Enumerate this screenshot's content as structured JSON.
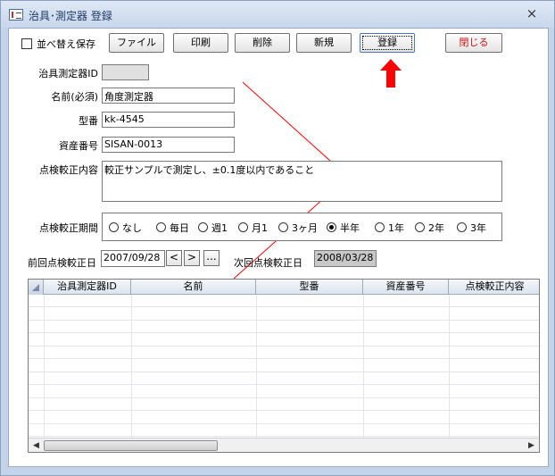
{
  "window": {
    "title": "治具･測定器  登録",
    "close_symbol": "×"
  },
  "toolbar": {
    "sort_save_label": "並べ替え保存",
    "buttons": {
      "file": "ファイル",
      "print": "印刷",
      "delete": "削除",
      "new": "新規",
      "register": "登録",
      "close": "閉じる"
    }
  },
  "form": {
    "labels": {
      "tool_id": "治具測定器ID",
      "name": "名前(必須)",
      "model": "型番",
      "asset_no": "資産番号",
      "inspection_content": "点検較正内容",
      "inspection_period": "点検較正期間",
      "last_date": "前回点検較正日",
      "next_date": "次回点検較正日"
    },
    "values": {
      "tool_id": "",
      "name": "角度測定器",
      "model": "kk-4545",
      "asset_no": "SISAN-0013",
      "inspection_content": "較正サンプルで測定し、±0.1度以内であること",
      "last_date": "2007/09/28",
      "next_date": "2008/03/28"
    },
    "period_options": [
      {
        "label": "なし",
        "selected": false
      },
      {
        "label": "毎日",
        "selected": false
      },
      {
        "label": "週1",
        "selected": false
      },
      {
        "label": "月1",
        "selected": false
      },
      {
        "label": "3ヶ月",
        "selected": false
      },
      {
        "label": "半年",
        "selected": true
      },
      {
        "label": "1年",
        "selected": false
      },
      {
        "label": "2年",
        "selected": false
      },
      {
        "label": "3年",
        "selected": false
      }
    ],
    "date_nav": {
      "prev": "<",
      "next": ">",
      "more": "..."
    }
  },
  "grid": {
    "columns": [
      "治具測定器ID",
      "名前",
      "型番",
      "資産番号",
      "点検較正内容"
    ]
  },
  "colors": {
    "annotation_arrow": "#ff0000",
    "annotation_line": "#ff0000"
  }
}
